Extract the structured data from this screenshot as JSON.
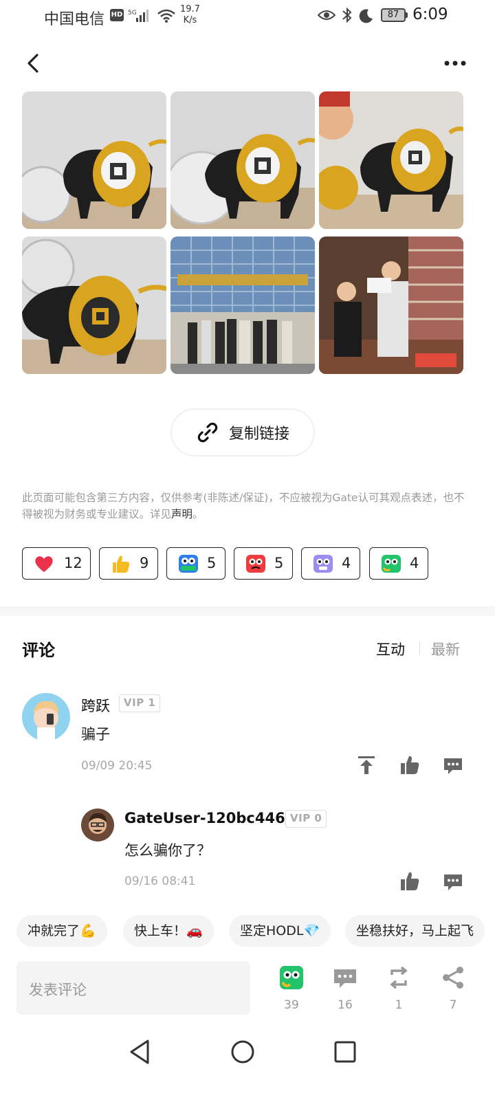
{
  "status_bar": {
    "carrier": "中国电信",
    "hd": "HD",
    "network": "5G",
    "speed_value": "19.7",
    "speed_unit": "K/s",
    "battery": "87",
    "time": "6:09"
  },
  "nav": {
    "back_icon": "chevron-left-icon",
    "more_icon": "more-dots-icon"
  },
  "images": [
    {
      "name": "bull-statue-photo-1"
    },
    {
      "name": "bull-statue-photo-2"
    },
    {
      "name": "bull-statue-photo-3"
    },
    {
      "name": "bull-statue-photo-4"
    },
    {
      "name": "group-photo-building"
    },
    {
      "name": "presentation-photo"
    }
  ],
  "copy_link": {
    "label": "复制链接",
    "icon": "link-icon"
  },
  "disclaimer": {
    "text": "此页面可能包含第三方内容，仅供参考(非陈述/保证)，不应被视为Gate认可其观点表述，也不得被视为财务或专业建议。详见",
    "link": "声明",
    "end": "。"
  },
  "reactions": [
    {
      "icon": "heart-icon",
      "count": "12"
    },
    {
      "icon": "thumbs-up-icon",
      "count": "9"
    },
    {
      "icon": "hodl-icon",
      "count": "5"
    },
    {
      "icon": "angry-face-icon",
      "count": "5"
    },
    {
      "icon": "shocked-face-icon",
      "count": "4"
    },
    {
      "icon": "green-face-icon",
      "count": "4"
    }
  ],
  "comments": {
    "title": "评论",
    "sort_interact": "互动",
    "sort_latest": "最新",
    "items": [
      {
        "user": "跨跃",
        "vip": "VIP 1",
        "text": "骗子",
        "time": "09/09 20:45"
      },
      {
        "user": "GateUser-120bc446",
        "vip": "VIP 0",
        "text": "怎么骗你了？",
        "time": "09/16 08:41"
      }
    ]
  },
  "quick_replies": [
    "冲就完了💪",
    "快上车！🚗",
    "坚定HODL💎",
    "坐稳扶好，马上起飞"
  ],
  "composer": {
    "placeholder": "发表评论"
  },
  "bottom_bar": {
    "reaction_count": "39",
    "comment_count": "16",
    "repost_count": "1",
    "share_count": "7"
  },
  "colors": {
    "accent": "#e8334a",
    "text": "#1a1a1a",
    "muted": "#999999"
  }
}
